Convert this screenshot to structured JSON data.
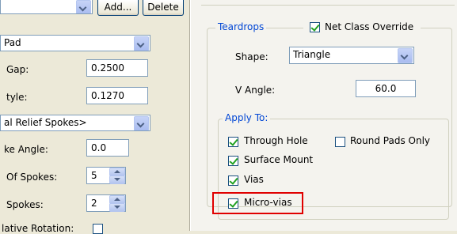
{
  "left": {
    "add_label": "Add...",
    "delete_label": "Delete",
    "pad_combo_value": "Pad",
    "gap_label": "Gap:",
    "gap_value": "0.2500",
    "style_label": "tyle:",
    "style_value": "0.1270",
    "relief_combo_value": "al Relief Spokes>",
    "spoke_angle_label": "ke Angle:",
    "spoke_angle_value": "0.0",
    "num_spokes_label": "Of Spokes:",
    "num_spokes_value": "5",
    "spokes_label": "Spokes:",
    "spokes_value": "2",
    "relative_rotation_label": "lative Rotation:",
    "relative_rotation_checked": false
  },
  "teardrops": {
    "title": "Teardrops",
    "net_class_override_label": "Net Class Override",
    "net_class_override_checked": true,
    "shape_label": "Shape:",
    "shape_value": "Triangle",
    "v_angle_label": "V Angle:",
    "v_angle_value": "60.0",
    "apply_to": {
      "title": "Apply To:",
      "options": [
        {
          "label": "Through Hole",
          "checked": true
        },
        {
          "label": "Round Pads Only",
          "checked": false
        },
        {
          "label": "Surface Mount",
          "checked": true
        },
        {
          "label": "Vias",
          "checked": true
        },
        {
          "label": "Micro-vias",
          "checked": true
        }
      ]
    }
  },
  "colors": {
    "group_title": "#0046d5",
    "highlight": "#e00000",
    "check": "#21a121"
  }
}
